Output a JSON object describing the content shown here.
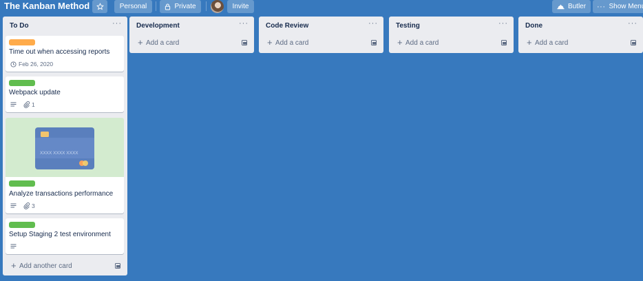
{
  "board": {
    "title": "The Kanban Method",
    "star_icon": "star-icon",
    "personal_label": "Personal",
    "private_label": "Private",
    "invite_label": "Invite",
    "butler_label": "Butler",
    "show_menu_label": "Show Menu"
  },
  "colors": {
    "background": "#3779be",
    "list_bg": "#ebecf0",
    "label_orange": "#ffab4a",
    "label_green": "#61bd4f",
    "cover_bg": "#d3ebcf",
    "credit_card": "#5a7fbd"
  },
  "lists": [
    {
      "title": "To Do",
      "menu": "···",
      "add_label": "Add another card",
      "cards": [
        {
          "label_color": "orange",
          "title": "Time out when accessing reports",
          "due_date": "Feb 26, 2020"
        },
        {
          "label_color": "green",
          "title": "Webpack update",
          "has_description": true,
          "attachments": "1"
        },
        {
          "label_color": "green",
          "title": "Analyze transactions performance",
          "has_cover": true,
          "cover_text": "XXXX  XXXX  XXXX",
          "has_description": true,
          "attachments": "3"
        },
        {
          "label_color": "green",
          "title": "Setup Staging 2 test environment",
          "has_description": true
        }
      ]
    },
    {
      "title": "Development",
      "menu": "···",
      "add_label": "Add a card",
      "cards": []
    },
    {
      "title": "Code Review",
      "menu": "···",
      "add_label": "Add a card",
      "cards": []
    },
    {
      "title": "Testing",
      "menu": "···",
      "add_label": "Add a card",
      "cards": []
    },
    {
      "title": "Done",
      "menu": "···",
      "add_label": "Add a card",
      "cards": []
    }
  ]
}
